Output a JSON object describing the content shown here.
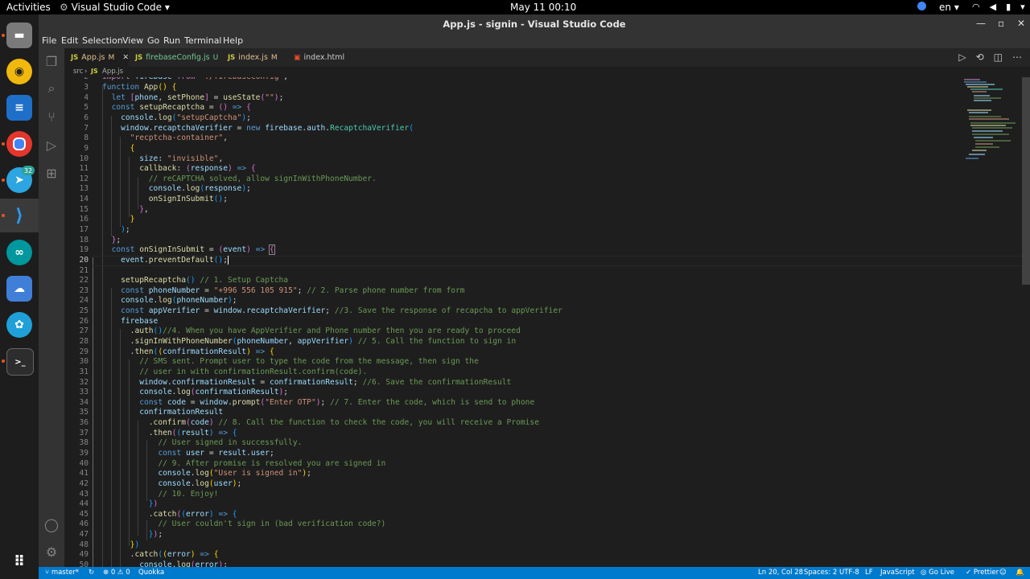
{
  "topbar": {
    "activities": "Activities",
    "app_name": "Visual Studio Code",
    "datetime": "May 11  00:10",
    "language": "en"
  },
  "dock": {
    "apps": [
      "files-icon",
      "rhythmbox-icon",
      "writer-icon",
      "chrome-icon",
      "telegram-icon",
      "vscode-icon",
      "arduino-icon",
      "cloud-icon",
      "app-icon",
      "terminal-icon",
      "app-grid-icon"
    ],
    "telegram_badge": "32"
  },
  "window": {
    "title": "App.js - signin - Visual Studio Code"
  },
  "menu": [
    "File",
    "Edit",
    "Selection",
    "View",
    "Go",
    "Run",
    "Terminal",
    "Help"
  ],
  "tabs": [
    {
      "icon": "JS",
      "name": "App.js",
      "status": "M",
      "active": true
    },
    {
      "icon": "JS",
      "name": "firebaseConfig.js",
      "status": "U"
    },
    {
      "icon": "JS",
      "name": "index.js",
      "status": "M"
    },
    {
      "icon": "html",
      "name": "index.html",
      "status": ""
    }
  ],
  "breadcrumb": {
    "folder": "src",
    "icon": "JS",
    "file": "App.js"
  },
  "editor": {
    "current_line": 20,
    "first_line_partial": "import firebase from \"./firebaseConfig\";"
  },
  "status": {
    "branch": "master*",
    "problems": "⊗ 0 ⚠ 0",
    "quokka": "Quokka",
    "position": "Ln 20, Col 28",
    "spaces": "Spaces: 2",
    "encoding": "UTF-8",
    "eol": "LF",
    "language": "JavaScript",
    "golive": "Go Live",
    "prettier": "✓ Prettier"
  },
  "colors": {
    "status_bg": "#007acc",
    "editor_bg": "#1e1e1e"
  }
}
